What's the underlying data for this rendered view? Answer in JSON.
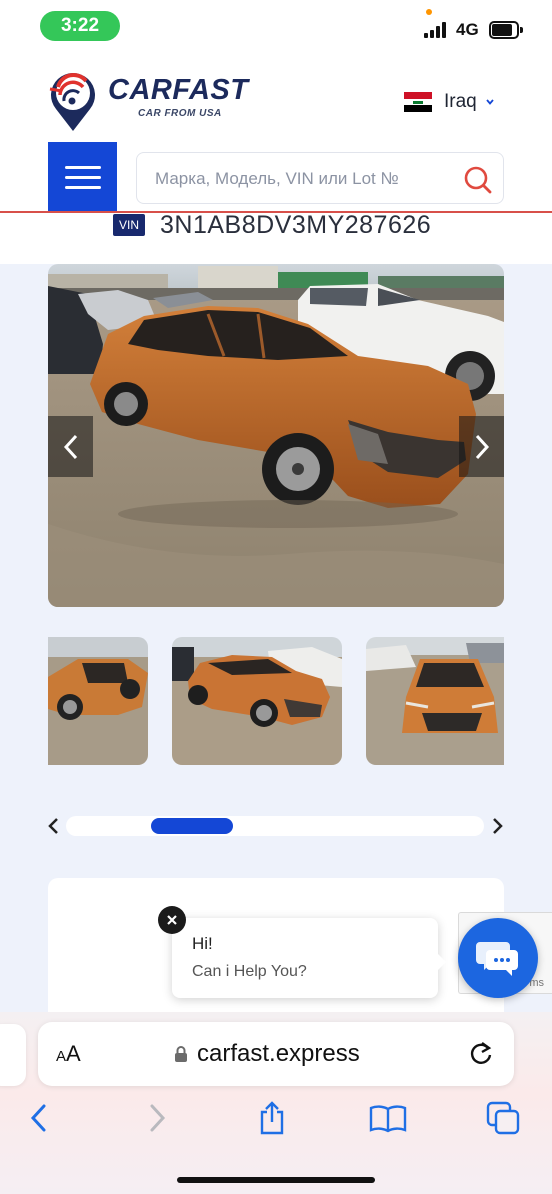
{
  "status_bar": {
    "time": "3:22",
    "network": "4G"
  },
  "header": {
    "brand": "CARFAST",
    "tagline": "CAR FROM USA",
    "country": "Iraq",
    "flag_colors": [
      "#ce1126",
      "#ffffff",
      "#000000"
    ]
  },
  "search": {
    "placeholder": "Марка, Модель, VIN или Lot №"
  },
  "vehicle": {
    "vin_label": "VIN",
    "vin": "3N1AB8DV3MY287626"
  },
  "gallery": {
    "thumbnail_count": 3,
    "slider_position": 0.24
  },
  "chat": {
    "greeting": "Hi!",
    "prompt": "Can i Help You?"
  },
  "recaptcha": {
    "text": "ms"
  },
  "browser": {
    "reader_label_small": "A",
    "reader_label_large": "A",
    "url": "carfast.express"
  },
  "colors": {
    "accent": "#1447d6",
    "brand_navy": "#1c2a5c",
    "logo_red": "#e0322d",
    "search_icon": "#e04a3f",
    "chat_blue": "#1c66e0",
    "safari_blue": "#1f6fe5"
  }
}
